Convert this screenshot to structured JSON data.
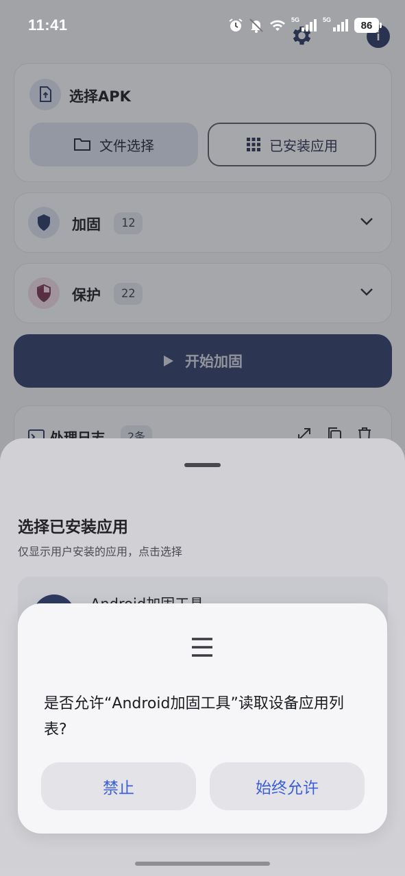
{
  "status_bar": {
    "time": "11:41",
    "net_tag_1": "5G",
    "net_tag_2": "5G",
    "battery": "86"
  },
  "apk_card": {
    "title": "选择APK",
    "file_button": "文件选择",
    "installed_button": "已安装应用"
  },
  "reinforce": {
    "label": "加固",
    "count": "12"
  },
  "protect": {
    "label": "保护",
    "count": "22"
  },
  "start_button": "开始加固",
  "log": {
    "title": "处理日志",
    "count": "2条"
  },
  "sheet": {
    "title": "选择已安装应用",
    "subtitle": "仅显示用户安装的应用，点击选择",
    "items": [
      {
        "name": "Android加固工具"
      }
    ]
  },
  "dialog": {
    "message": "是否允许“Android加固工具”读取设备应用列表?",
    "deny": "禁止",
    "allow": "始终允许"
  },
  "colors": {
    "primary": "#2f3c68",
    "dialog_accent": "#3c5fd6",
    "sheet_bg": "#f2f2f6"
  }
}
